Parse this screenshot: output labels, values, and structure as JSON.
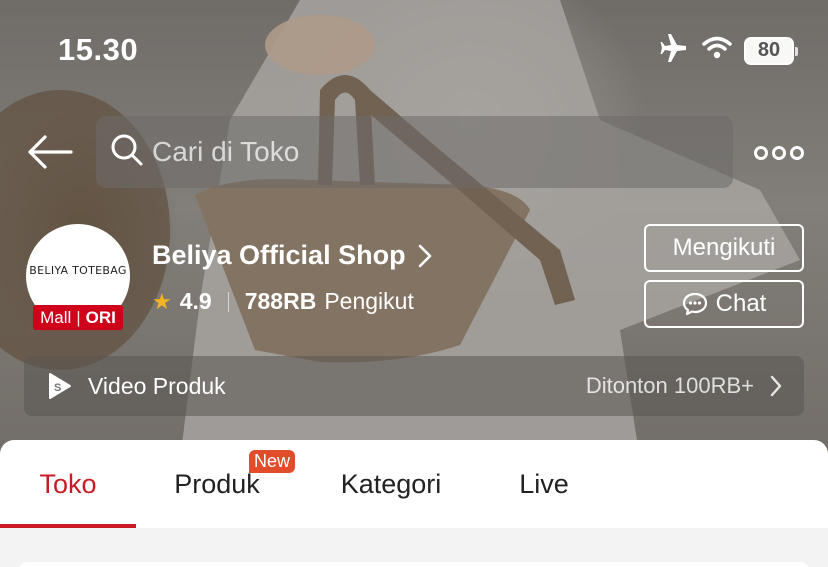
{
  "status_bar": {
    "time": "15.30",
    "battery": "80"
  },
  "search": {
    "placeholder": "Cari di Toko"
  },
  "shop": {
    "logo_text": "BELIYA TOTEBAG",
    "badge_mall": "Mall",
    "badge_ori": "ORI",
    "name": "Beliya Official Shop",
    "rating": "4.9",
    "followers_count": "788RB",
    "followers_label": "Pengikut"
  },
  "actions": {
    "follow_label": "Mengikuti",
    "chat_label": "Chat"
  },
  "video": {
    "label": "Video Produk",
    "views": "Ditonton 100RB+"
  },
  "tabs": [
    {
      "label": "Toko",
      "active": true
    },
    {
      "label": "Produk",
      "badge": "New"
    },
    {
      "label": "Kategori"
    },
    {
      "label": "Live"
    }
  ],
  "colors": {
    "accent": "#c81b24",
    "mall_red": "#d0011b",
    "star": "#f2b51f",
    "new_badge": "#e14d2a"
  }
}
